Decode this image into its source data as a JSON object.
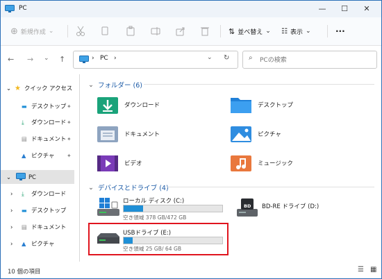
{
  "window": {
    "title": "PC"
  },
  "window_controls": {
    "minimize": "—",
    "maximize": "☐",
    "close": "✕"
  },
  "toolbar": {
    "new_label": "新規作成",
    "sort_label": "並べ替え",
    "view_label": "表示",
    "more_label": "···"
  },
  "address": {
    "path": "PC",
    "separator": "›"
  },
  "search": {
    "placeholder": "PCの検索"
  },
  "nav": {
    "quick_access": "クイック アクセス",
    "qa_items": [
      {
        "label": "デスクトップ"
      },
      {
        "label": "ダウンロード"
      },
      {
        "label": "ドキュメント"
      },
      {
        "label": "ピクチャ"
      }
    ],
    "pc": "PC",
    "pc_items": [
      {
        "label": "ダウンロード"
      },
      {
        "label": "デスクトップ"
      },
      {
        "label": "ドキュメント"
      },
      {
        "label": "ピクチャ"
      }
    ]
  },
  "folders": {
    "header": "フォルダー (6)",
    "items": [
      {
        "label": "ダウンロード"
      },
      {
        "label": "デスクトップ"
      },
      {
        "label": "ドキュメント"
      },
      {
        "label": "ピクチャ"
      },
      {
        "label": "ビデオ"
      },
      {
        "label": "ミュージック"
      }
    ]
  },
  "drives": {
    "header": "デバイスとドライブ (4)",
    "c": {
      "label": "ローカル ディスク (C:)",
      "space": "空き領域 378 GB/472 GB",
      "used_fraction": 0.2
    },
    "bd": {
      "label": "BD-RE ドライブ (D:)",
      "badge": "BD"
    },
    "usb": {
      "label": "USBドライブ (E:)",
      "space": "空き領域 25 GB/  64 GB",
      "used_fraction": 0.09
    }
  },
  "status": {
    "count": "10 個の項目"
  },
  "colors": {
    "accent": "#1b5aa6",
    "highlight": "#e0141e",
    "bar": "#1f8fd6"
  }
}
